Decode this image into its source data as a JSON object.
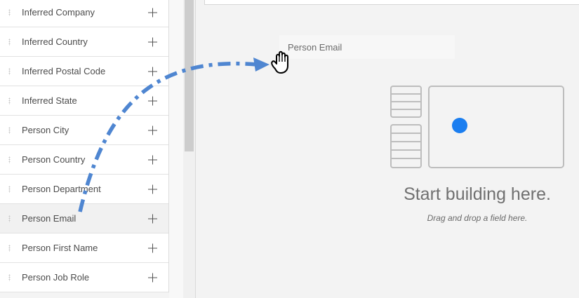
{
  "field_list": {
    "items": [
      {
        "label": "Inferred Company"
      },
      {
        "label": "Inferred Country"
      },
      {
        "label": "Inferred Postal Code"
      },
      {
        "label": "Inferred State"
      },
      {
        "label": "Person City"
      },
      {
        "label": "Person Country"
      },
      {
        "label": "Person Department"
      },
      {
        "label": "Person Email",
        "selected": true
      },
      {
        "label": "Person First Name"
      },
      {
        "label": "Person Job Role"
      }
    ]
  },
  "drag": {
    "ghost_label": "Person Email",
    "arrow_color": "#4f86d1"
  },
  "canvas": {
    "empty_title": "Start building here.",
    "empty_hint": "Drag and drop a field here.",
    "accent_dot_color": "#1b7ef0"
  },
  "icons": {
    "add": "plus-icon",
    "drag_handle": "grip-icon",
    "cursor": "hand-grab-cursor-icon"
  }
}
